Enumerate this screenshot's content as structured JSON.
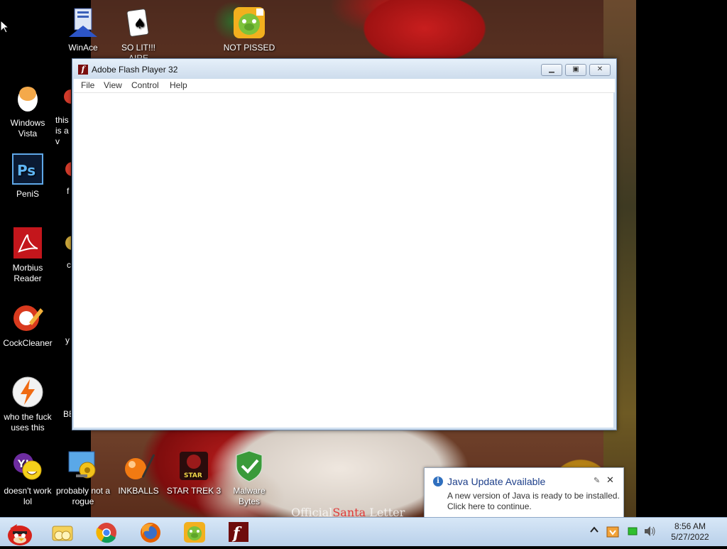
{
  "desktop": {
    "icons": [
      {
        "label": "WinAce Archiver",
        "icon": "winace-icon"
      },
      {
        "label": "SO LIT!!! AIRE",
        "icon": "solitaire-icon"
      },
      {
        "label": "NOT PISSED BIRD GAME",
        "icon": "angry-pig-icon"
      },
      {
        "label": "Windows Vista",
        "icon": "egg-icon"
      },
      {
        "label": "this is a v",
        "icon": "partial-icon"
      },
      {
        "label": "PeniS",
        "icon": "photoshop-icon"
      },
      {
        "label": "f",
        "icon": "partial-icon"
      },
      {
        "label": "Morbius Reader",
        "icon": "acrobat-icon"
      },
      {
        "label": "c",
        "icon": "partial-icon"
      },
      {
        "label": "CockCleaner",
        "icon": "ccleaner-icon"
      },
      {
        "label": "y",
        "icon": "partial-icon"
      },
      {
        "label": "who the fuck uses this",
        "icon": "winamp-icon"
      },
      {
        "label": "BE",
        "icon": "partial-icon"
      },
      {
        "label": "doesn't work lol",
        "icon": "yahoo-messenger-icon"
      },
      {
        "label": "probably not a rogue",
        "icon": "control-panel-icon"
      },
      {
        "label": "INKBALLS",
        "icon": "inkball-icon"
      },
      {
        "label": "STAR TREK 3",
        "icon": "star-wars-icon"
      },
      {
        "label": "Malware Bytes",
        "icon": "shield-check-icon"
      }
    ],
    "watermark": {
      "prefix": "Official",
      "highlight": "Santa",
      "suffix": " Letter"
    }
  },
  "window": {
    "title": "Adobe Flash Player 32",
    "app_icon": "flash-icon",
    "menu": [
      "File",
      "View",
      "Control",
      "Help"
    ],
    "controls": {
      "minimize": "minimize-icon",
      "maximize": "maximize-icon",
      "close": "close-icon"
    }
  },
  "notification": {
    "title": "Java Update Available",
    "line1": "A new version of Java is ready to be installed.",
    "line2": "Click here to continue.",
    "icon": "info-icon"
  },
  "taskbar": {
    "start": "angry-bird-start-icon",
    "pinned": [
      "explorer-icon",
      "chrome-icon",
      "firefox-icon",
      "angry-pig-icon",
      "flash-icon"
    ],
    "tray": [
      "show-hidden-icons-icon",
      "java-update-icon",
      "network-icon",
      "volume-icon"
    ],
    "clock": {
      "time": "8:56 AM",
      "date": "5/27/2022"
    }
  },
  "colors": {
    "taskbar_bg": "#c6dbf0",
    "java_title": "#1d3f8a",
    "flash_red": "#7a0e0e"
  }
}
